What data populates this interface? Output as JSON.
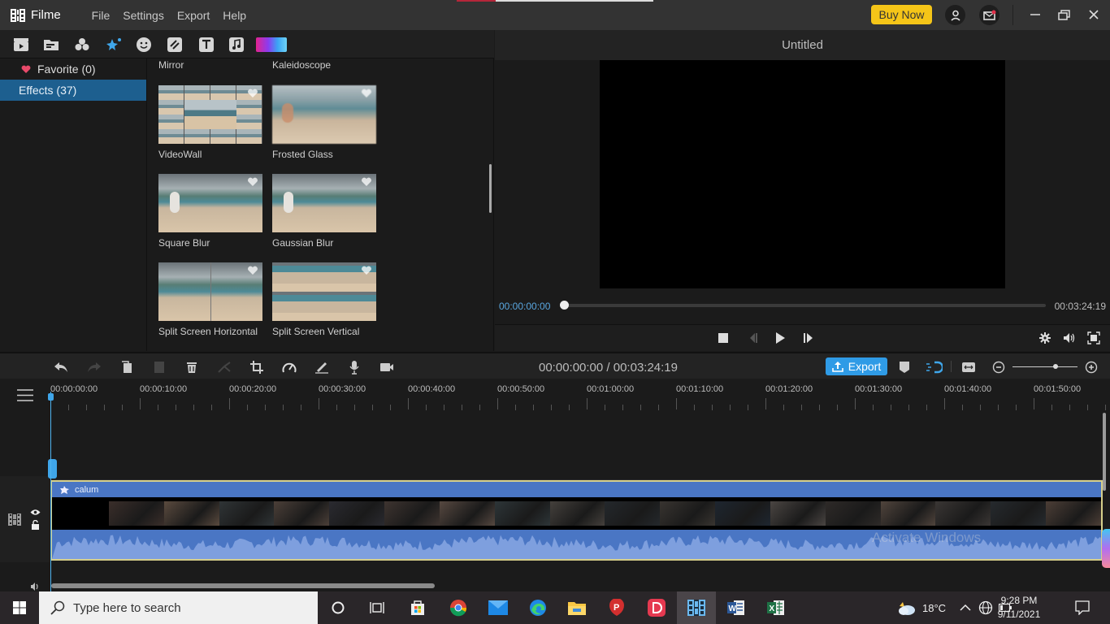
{
  "app": {
    "name": "Filme",
    "menu": [
      "File",
      "Settings",
      "Export",
      "Help"
    ],
    "buy_now": "Buy Now",
    "icons": [
      "account-icon",
      "mail-icon",
      "minimize-icon",
      "restore-icon",
      "close-icon"
    ]
  },
  "toolbar": {
    "tabs": [
      {
        "name": "media-tab",
        "icon": "clapper-icon"
      },
      {
        "name": "files-tab",
        "icon": "folder-icon"
      },
      {
        "name": "filters-tab",
        "icon": "circles-icon"
      },
      {
        "name": "effects-tab",
        "icon": "magic-wand-icon",
        "active": true
      },
      {
        "name": "stickers-tab",
        "icon": "smiley-icon"
      },
      {
        "name": "transitions-tab",
        "icon": "transition-icon"
      },
      {
        "name": "text-tab",
        "icon": "text-icon"
      },
      {
        "name": "audio-tab",
        "icon": "music-icon"
      },
      {
        "name": "background-tab",
        "icon": "gradient-icon"
      }
    ]
  },
  "categories": [
    {
      "label": "Favorite (0)",
      "icon": "heart-icon",
      "selected": false
    },
    {
      "label": "Effects (37)",
      "selected": true
    }
  ],
  "effects": {
    "partial_top": [
      "Mirror",
      "Kaleidoscope"
    ],
    "items": [
      {
        "label": "VideoWall"
      },
      {
        "label": "Frosted Glass"
      },
      {
        "label": "Square Blur"
      },
      {
        "label": "Gaussian Blur"
      },
      {
        "label": "Split Screen Horizontal"
      },
      {
        "label": "Split Screen Vertical"
      }
    ]
  },
  "preview": {
    "title": "Untitled",
    "current_time": "00:00:00:00",
    "total_time": "00:03:24:19",
    "progress": 0
  },
  "timeline": {
    "time_display": "00:00:00:00 / 00:03:24:19",
    "export_label": "Export",
    "zoom_level": 0.78,
    "ruler_labels": [
      "00:00:00:00",
      "00:00:10:00",
      "00:00:20:00",
      "00:00:30:00",
      "00:00:40:00",
      "00:00:50:00",
      "00:01:00:00",
      "00:01:10:00",
      "00:01:20:00",
      "00:01:30:00",
      "00:01:40:00",
      "00:01:50:00"
    ],
    "clip_name": "calum",
    "watermark": "Activate Windows"
  },
  "taskbar": {
    "search_placeholder": "Type here to search",
    "weather": "18°C",
    "time": "9:28 PM",
    "date": "9/11/2021",
    "apps": [
      "cortana-icon",
      "task-view-icon",
      "store-icon",
      "chrome-icon",
      "mail-app-icon",
      "edge-icon",
      "file-explorer-icon",
      "wps-icon",
      "app-d-icon",
      "filme-app-icon",
      "word-icon",
      "excel-icon"
    ]
  }
}
